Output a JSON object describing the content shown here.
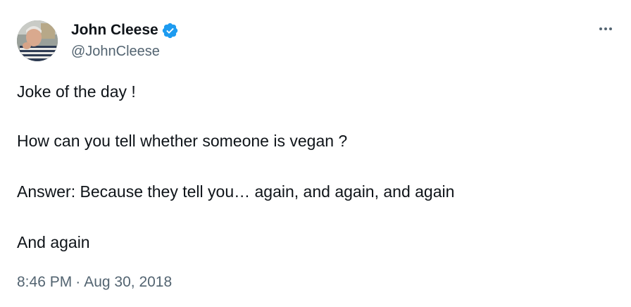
{
  "author": {
    "display_name": "John Cleese",
    "handle": "@JohnCleese",
    "verified_icon": "verified-badge-icon",
    "verified_color": "#1d9bf0"
  },
  "menu": {
    "icon": "more-options-icon"
  },
  "tweet": {
    "lines": [
      "Joke of the day !",
      "How can you tell whether someone is vegan ?",
      "Answer: Because they tell you… again, and again, and again",
      "And again"
    ],
    "time": "8:46 PM",
    "separator": "·",
    "date": "Aug 30, 2018"
  },
  "colors": {
    "text": "#0f1419",
    "secondary": "#536471",
    "background": "#ffffff"
  }
}
